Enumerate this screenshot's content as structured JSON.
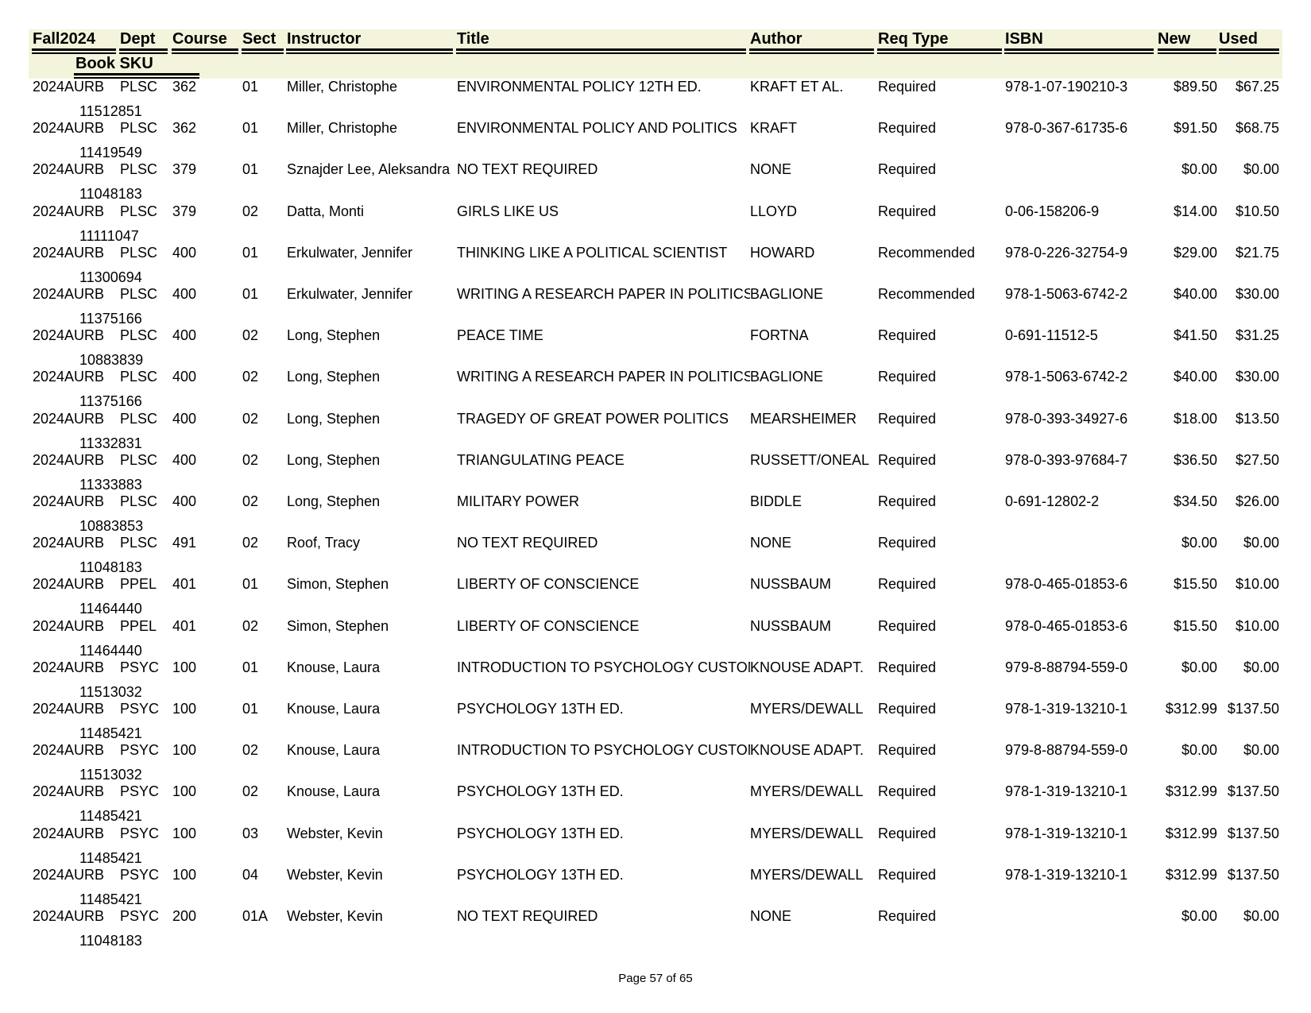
{
  "headers": {
    "term": "Fall2024",
    "dept": "Dept",
    "course": "Course",
    "sect": "Sect",
    "instructor": "Instructor",
    "title": "Title",
    "author": "Author",
    "req_type": "Req Type",
    "isbn": "ISBN",
    "new": "New",
    "used": "Used",
    "book_sku": "Book SKU"
  },
  "rows": [
    {
      "term": "2024AURB",
      "dept": "PLSC",
      "course": "362",
      "sect": "01",
      "instructor": "Miller, Christophe",
      "title": "ENVIRONMENTAL POLICY 12TH ED.",
      "author": "KRAFT ET AL.",
      "req_type": "Required",
      "isbn": "978-1-07-190210-3",
      "new": "$89.50",
      "used": "$67.25",
      "sku": "11512851"
    },
    {
      "term": "2024AURB",
      "dept": "PLSC",
      "course": "362",
      "sect": "01",
      "instructor": "Miller, Christophe",
      "title": "ENVIRONMENTAL POLICY AND POLITICS",
      "author": "KRAFT",
      "req_type": "Required",
      "isbn": "978-0-367-61735-6",
      "new": "$91.50",
      "used": "$68.75",
      "sku": "11419549"
    },
    {
      "term": "2024AURB",
      "dept": "PLSC",
      "course": "379",
      "sect": "01",
      "instructor": "Sznajder Lee, Aleksandra",
      "title": "NO TEXT REQUIRED",
      "author": "NONE",
      "req_type": "Required",
      "isbn": "",
      "new": "$0.00",
      "used": "$0.00",
      "sku": "11048183"
    },
    {
      "term": "2024AURB",
      "dept": "PLSC",
      "course": "379",
      "sect": "02",
      "instructor": "Datta, Monti",
      "title": "GIRLS LIKE US",
      "author": "LLOYD",
      "req_type": "Required",
      "isbn": "0-06-158206-9",
      "new": "$14.00",
      "used": "$10.50",
      "sku": "11111047"
    },
    {
      "term": "2024AURB",
      "dept": "PLSC",
      "course": "400",
      "sect": "01",
      "instructor": "Erkulwater, Jennifer",
      "title": "THINKING LIKE A POLITICAL SCIENTIST",
      "author": "HOWARD",
      "req_type": "Recommended",
      "isbn": "978-0-226-32754-9",
      "new": "$29.00",
      "used": "$21.75",
      "sku": "11300694"
    },
    {
      "term": "2024AURB",
      "dept": "PLSC",
      "course": "400",
      "sect": "01",
      "instructor": "Erkulwater, Jennifer",
      "title": "WRITING A RESEARCH PAPER IN POLITICS",
      "author": "BAGLIONE",
      "req_type": "Recommended",
      "isbn": "978-1-5063-6742-2",
      "new": "$40.00",
      "used": "$30.00",
      "sku": "11375166"
    },
    {
      "term": "2024AURB",
      "dept": "PLSC",
      "course": "400",
      "sect": "02",
      "instructor": "Long, Stephen",
      "title": "PEACE TIME",
      "author": "FORTNA",
      "req_type": "Required",
      "isbn": "0-691-11512-5",
      "new": "$41.50",
      "used": "$31.25",
      "sku": "10883839"
    },
    {
      "term": "2024AURB",
      "dept": "PLSC",
      "course": "400",
      "sect": "02",
      "instructor": "Long, Stephen",
      "title": "WRITING A RESEARCH PAPER IN POLITICS",
      "author": "BAGLIONE",
      "req_type": "Required",
      "isbn": "978-1-5063-6742-2",
      "new": "$40.00",
      "used": "$30.00",
      "sku": "11375166"
    },
    {
      "term": "2024AURB",
      "dept": "PLSC",
      "course": "400",
      "sect": "02",
      "instructor": "Long, Stephen",
      "title": "TRAGEDY OF GREAT POWER POLITICS",
      "author": "MEARSHEIMER",
      "req_type": "Required",
      "isbn": "978-0-393-34927-6",
      "new": "$18.00",
      "used": "$13.50",
      "sku": "11332831"
    },
    {
      "term": "2024AURB",
      "dept": "PLSC",
      "course": "400",
      "sect": "02",
      "instructor": "Long, Stephen",
      "title": "TRIANGULATING PEACE",
      "author": "RUSSETT/ONEAL",
      "req_type": "Required",
      "isbn": "978-0-393-97684-7",
      "new": "$36.50",
      "used": "$27.50",
      "sku": "11333883"
    },
    {
      "term": "2024AURB",
      "dept": "PLSC",
      "course": "400",
      "sect": "02",
      "instructor": "Long, Stephen",
      "title": "MILITARY POWER",
      "author": "BIDDLE",
      "req_type": "Required",
      "isbn": "0-691-12802-2",
      "new": "$34.50",
      "used": "$26.00",
      "sku": "10883853"
    },
    {
      "term": "2024AURB",
      "dept": "PLSC",
      "course": "491",
      "sect": "02",
      "instructor": "Roof, Tracy",
      "title": "NO TEXT REQUIRED",
      "author": "NONE",
      "req_type": "Required",
      "isbn": "",
      "new": "$0.00",
      "used": "$0.00",
      "sku": "11048183"
    },
    {
      "term": "2024AURB",
      "dept": "PPEL",
      "course": "401",
      "sect": "01",
      "instructor": "Simon, Stephen",
      "title": "LIBERTY OF CONSCIENCE",
      "author": "NUSSBAUM",
      "req_type": "Required",
      "isbn": "978-0-465-01853-6",
      "new": "$15.50",
      "used": "$10.00",
      "sku": "11464440"
    },
    {
      "term": "2024AURB",
      "dept": "PPEL",
      "course": "401",
      "sect": "02",
      "instructor": "Simon, Stephen",
      "title": "LIBERTY OF CONSCIENCE",
      "author": "NUSSBAUM",
      "req_type": "Required",
      "isbn": "978-0-465-01853-6",
      "new": "$15.50",
      "used": "$10.00",
      "sku": "11464440"
    },
    {
      "term": "2024AURB",
      "dept": "PSYC",
      "course": "100",
      "sect": "01",
      "instructor": "Knouse, Laura",
      "title": "INTRODUCTION TO PSYCHOLOGY CUSTOM",
      "author": "KNOUSE ADAPT.",
      "req_type": "Required",
      "isbn": "979-8-88794-559-0",
      "new": "$0.00",
      "used": "$0.00",
      "sku": "11513032"
    },
    {
      "term": "2024AURB",
      "dept": "PSYC",
      "course": "100",
      "sect": "01",
      "instructor": "Knouse, Laura",
      "title": "PSYCHOLOGY 13TH ED.",
      "author": "MYERS/DEWALL",
      "req_type": "Required",
      "isbn": "978-1-319-13210-1",
      "new": "$312.99",
      "used": "$137.50",
      "sku": "11485421"
    },
    {
      "term": "2024AURB",
      "dept": "PSYC",
      "course": "100",
      "sect": "02",
      "instructor": "Knouse, Laura",
      "title": "INTRODUCTION TO PSYCHOLOGY CUSTOM",
      "author": "KNOUSE ADAPT.",
      "req_type": "Required",
      "isbn": "979-8-88794-559-0",
      "new": "$0.00",
      "used": "$0.00",
      "sku": "11513032"
    },
    {
      "term": "2024AURB",
      "dept": "PSYC",
      "course": "100",
      "sect": "02",
      "instructor": "Knouse, Laura",
      "title": "PSYCHOLOGY 13TH ED.",
      "author": "MYERS/DEWALL",
      "req_type": "Required",
      "isbn": "978-1-319-13210-1",
      "new": "$312.99",
      "used": "$137.50",
      "sku": "11485421"
    },
    {
      "term": "2024AURB",
      "dept": "PSYC",
      "course": "100",
      "sect": "03",
      "instructor": "Webster, Kevin",
      "title": "PSYCHOLOGY 13TH ED.",
      "author": "MYERS/DEWALL",
      "req_type": "Required",
      "isbn": "978-1-319-13210-1",
      "new": "$312.99",
      "used": "$137.50",
      "sku": "11485421"
    },
    {
      "term": "2024AURB",
      "dept": "PSYC",
      "course": "100",
      "sect": "04",
      "instructor": "Webster, Kevin",
      "title": "PSYCHOLOGY 13TH ED.",
      "author": "MYERS/DEWALL",
      "req_type": "Required",
      "isbn": "978-1-319-13210-1",
      "new": "$312.99",
      "used": "$137.50",
      "sku": "11485421"
    },
    {
      "term": "2024AURB",
      "dept": "PSYC",
      "course": "200",
      "sect": "01A",
      "instructor": "Webster, Kevin",
      "title": "NO TEXT REQUIRED",
      "author": "NONE",
      "req_type": "Required",
      "isbn": "",
      "new": "$0.00",
      "used": "$0.00",
      "sku": "11048183"
    }
  ],
  "footer": {
    "page_label": "Page 57 of 65"
  }
}
